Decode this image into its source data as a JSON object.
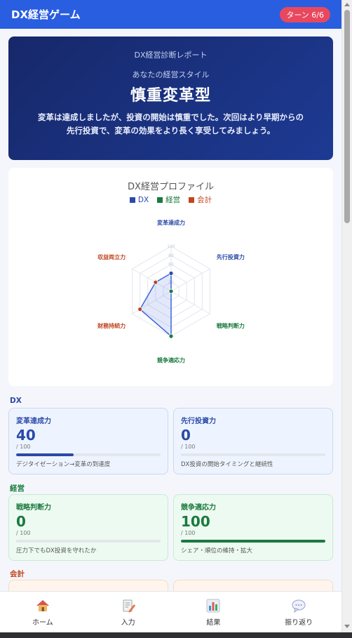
{
  "app": {
    "title": "DX経営ゲーム",
    "turn_badge": "ターン 6/6"
  },
  "hero": {
    "kicker": "DX経営診断レポート",
    "subtitle": "あなたの経営スタイル",
    "style_name": "慎重変革型",
    "description": "変革は達成しましたが、投資の開始は慎重でした。次回はより早期からの先行投資で、変革の効果をより長く享受してみましょう。"
  },
  "chart_data": {
    "type": "radar",
    "title": "DX経営プロファイル",
    "legend": [
      {
        "name": "DX",
        "color": "#2a4aa8"
      },
      {
        "name": "経営",
        "color": "#1a7a3e"
      },
      {
        "name": "会計",
        "color": "#c0441e"
      }
    ],
    "axes": [
      "変革達成力",
      "先行投資力",
      "戦略判断力",
      "競争適応力",
      "財務持続力",
      "収益両立力"
    ],
    "axis_groups": [
      "DX",
      "DX",
      "経営",
      "経営",
      "会計",
      "会計"
    ],
    "values": [
      40,
      0,
      0,
      100,
      80,
      40
    ],
    "range": [
      0,
      100
    ],
    "rings": 5,
    "ring_labels": [
      "0",
      "20",
      "40",
      "60",
      "80",
      "100"
    ]
  },
  "sections": {
    "dx": {
      "label": "DX",
      "color": "#2a4aa8"
    },
    "mgmt": {
      "label": "経営",
      "color": "#1a7a3e"
    },
    "acct": {
      "label": "会計",
      "color": "#c0441e"
    }
  },
  "metrics": [
    {
      "name": "変革達成力",
      "value": "40",
      "max": "/ 100",
      "percent": 40,
      "description": "デジタイゼーション→変革の到達度",
      "group": "dx"
    },
    {
      "name": "先行投資力",
      "value": "0",
      "max": "/ 100",
      "percent": 0,
      "description": "DX投資の開始タイミングと継続性",
      "group": "dx"
    },
    {
      "name": "戦略判断力",
      "value": "0",
      "max": "/ 100",
      "percent": 0,
      "description": "圧力下でもDX投資を守れたか",
      "group": "mg"
    },
    {
      "name": "競争適応力",
      "value": "100",
      "max": "/ 100",
      "percent": 100,
      "description": "シェア・順位の維持・拡大",
      "group": "mg"
    }
  ],
  "nav": [
    {
      "label": "ホーム",
      "icon": "home-icon"
    },
    {
      "label": "入力",
      "icon": "memo-icon"
    },
    {
      "label": "結果",
      "icon": "bar-chart-icon"
    },
    {
      "label": "振り返り",
      "icon": "speech-bubble-icon"
    }
  ]
}
